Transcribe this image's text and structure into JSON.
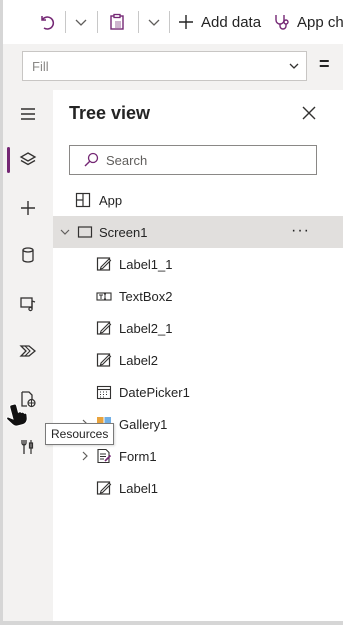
{
  "toolbar": {
    "add_data_label": "Add data",
    "app_checker_label": "App ch"
  },
  "formula_bar": {
    "property_value": "Fill",
    "equals_sign": "="
  },
  "rail": {
    "items": [
      {
        "icon": "hamburger-icon"
      },
      {
        "icon": "layers-icon",
        "active": true
      },
      {
        "icon": "plus-icon"
      },
      {
        "icon": "database-icon"
      },
      {
        "icon": "media-icon"
      },
      {
        "icon": "power-automate-icon"
      },
      {
        "icon": "resources-icon"
      },
      {
        "icon": "tools-icon"
      }
    ],
    "accent_color": "#742774"
  },
  "tree_view": {
    "title": "Tree view",
    "search_placeholder": "Search",
    "app_label": "App",
    "screen_label": "Screen1",
    "more_label": "···",
    "items": [
      {
        "label": "Label1_1",
        "icon": "label-icon"
      },
      {
        "label": "TextBox2",
        "icon": "textbox-icon"
      },
      {
        "label": "Label2_1",
        "icon": "label-icon"
      },
      {
        "label": "Label2",
        "icon": "label-icon"
      },
      {
        "label": "DatePicker1",
        "icon": "calendar-icon"
      },
      {
        "label": "Gallery1",
        "icon": "gallery-icon",
        "expandable": true
      },
      {
        "label": "Form1",
        "icon": "form-icon",
        "expandable": true
      },
      {
        "label": "Label1",
        "icon": "label-icon"
      }
    ]
  },
  "tooltip": {
    "text": "Resources"
  }
}
